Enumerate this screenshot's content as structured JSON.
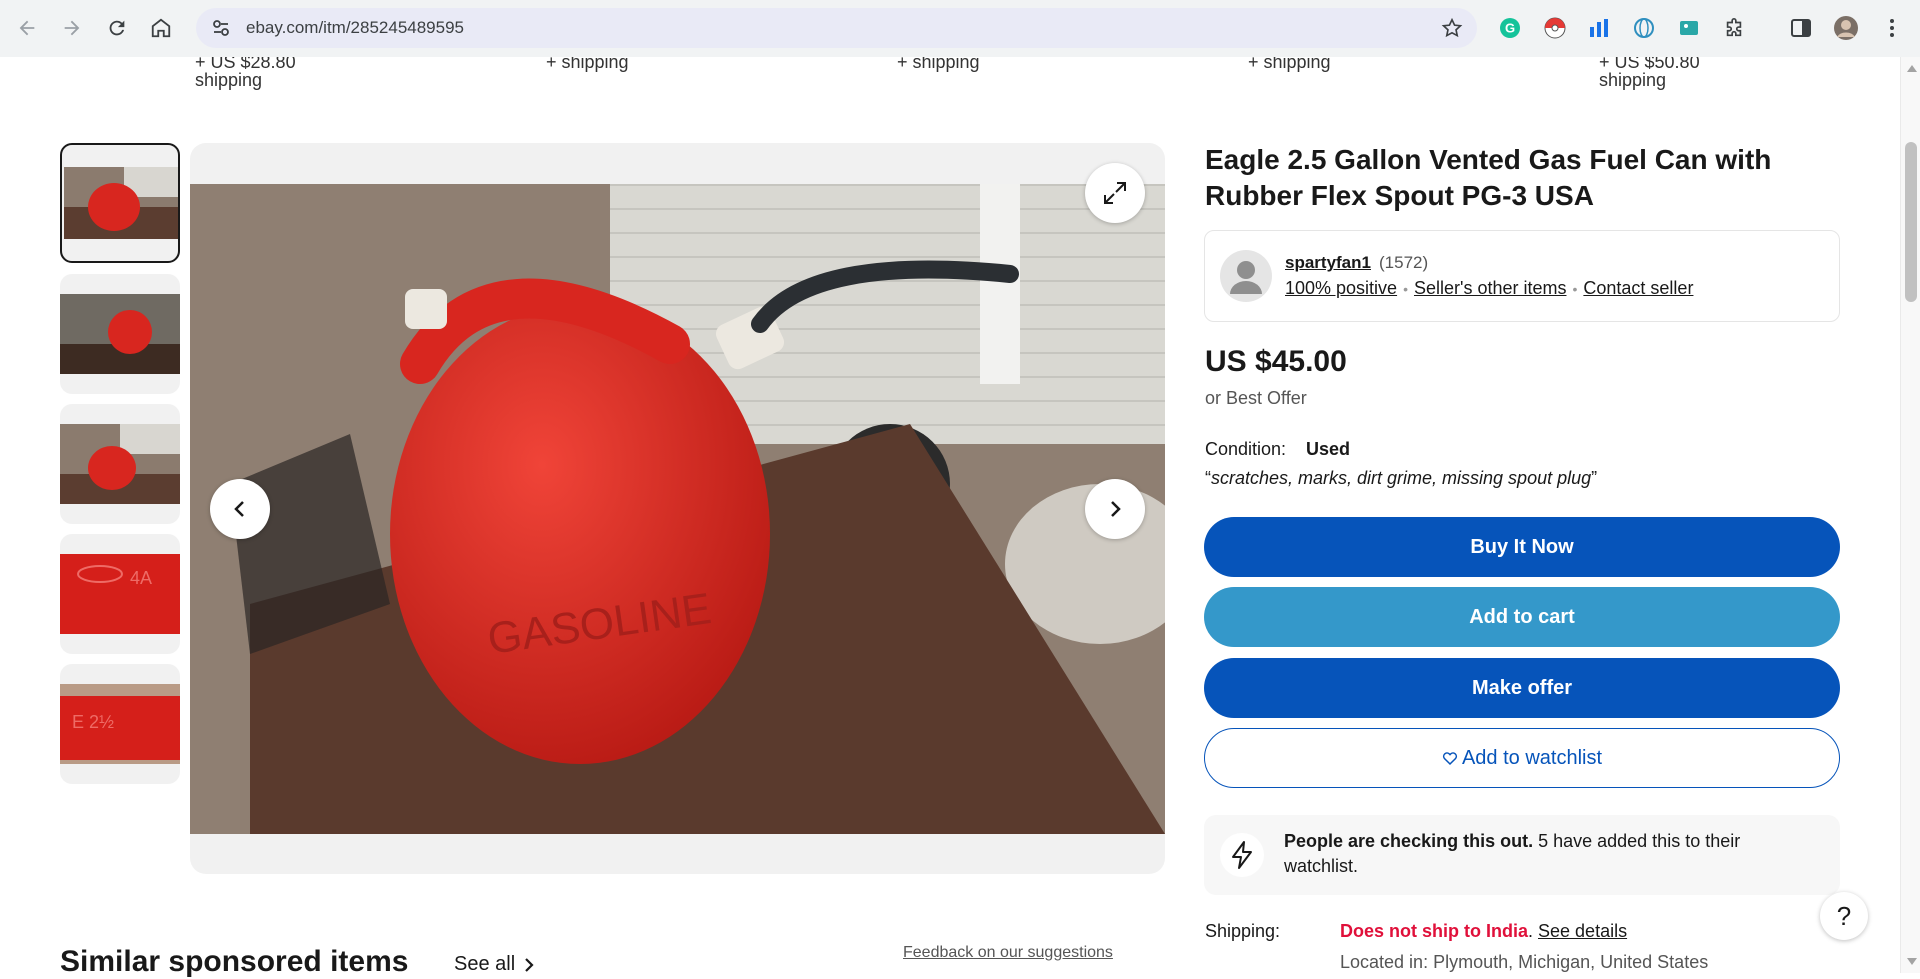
{
  "browser": {
    "url": "ebay.com/itm/285245489595"
  },
  "shipping_strip": [
    {
      "line1": "+ US $28.80",
      "line2": "shipping"
    },
    {
      "line1": "+ shipping",
      "line2": ""
    },
    {
      "line1": "+ shipping",
      "line2": ""
    },
    {
      "line1": "+ shipping",
      "line2": ""
    },
    {
      "line1": "+ US $50.80",
      "line2": "shipping"
    }
  ],
  "listing": {
    "title": "Eagle 2.5 Gallon Vented Gas Fuel Can with Rubber Flex Spout PG-3 USA",
    "seller": {
      "name": "spartyfan1",
      "score": "(1572)",
      "positive": "100% positive",
      "other_items": "Seller's other items",
      "contact": "Contact seller"
    },
    "price": "US $45.00",
    "best_offer": "or Best Offer",
    "condition_label": "Condition:",
    "condition_value": "Used",
    "condition_note": "scratches, marks, dirt grime, missing spout plug",
    "buttons": {
      "buy": "Buy It Now",
      "cart": "Add to cart",
      "offer": "Make offer",
      "watch": "Add to watchlist"
    },
    "alert_bold": "People are checking this out.",
    "alert_text": " 5 have added this to their watchlist.",
    "shipping_label": "Shipping:",
    "shipping_warning": "Does not ship to India",
    "shipping_details": "See details",
    "located": "Located in: Plymouth, Michigan, United States"
  },
  "similar": {
    "title": "Similar sponsored items",
    "see_all": "See all",
    "feedback": "Feedback on our suggestions"
  },
  "help": "?",
  "colors": {
    "primary_blue": "#0654ba",
    "cart_blue": "#3498ca",
    "warning_red": "#e0103a"
  }
}
